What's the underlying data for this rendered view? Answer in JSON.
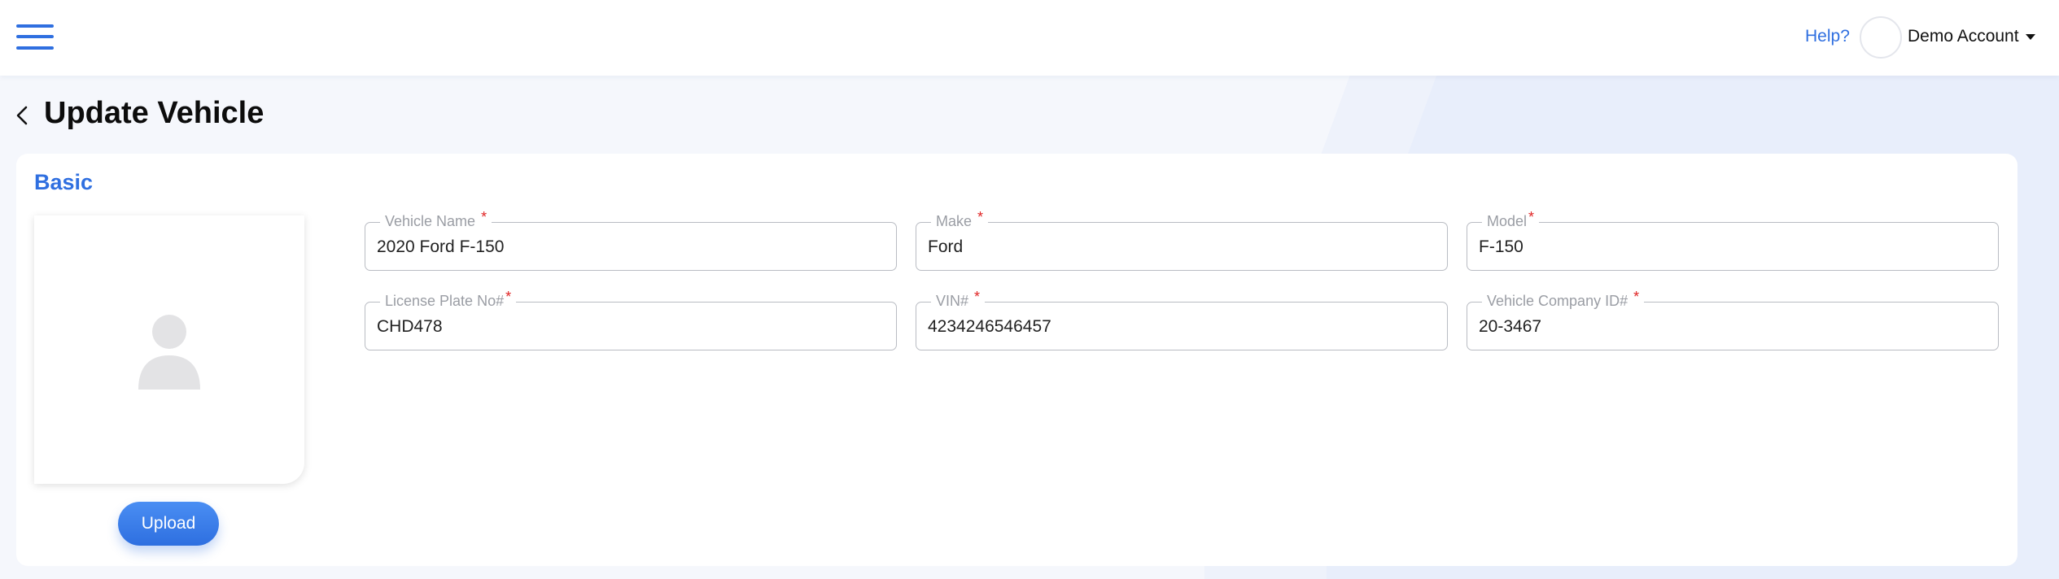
{
  "header": {
    "help_label": "Help?",
    "account_name": "Demo Account",
    "accent_color": "#2f6fe0"
  },
  "page": {
    "title": "Update Vehicle"
  },
  "section": {
    "title": "Basic",
    "upload_label": "Upload"
  },
  "fields": {
    "vehicle_name": {
      "label": "Vehicle Name",
      "required": "*",
      "value": "2020 Ford F-150"
    },
    "make": {
      "label": "Make",
      "required": "*",
      "value": "Ford"
    },
    "model": {
      "label": "Model",
      "required": "*",
      "value": "F-150"
    },
    "license_plate": {
      "label": "License Plate No#",
      "required": "*",
      "value": "CHD478"
    },
    "vin": {
      "label": "VIN#",
      "required": "*",
      "value": "4234246546457"
    },
    "company_id": {
      "label": "Vehicle Company ID#",
      "required": "*",
      "value": "20-3467"
    }
  },
  "icons": {
    "menu": "hamburger-menu-icon",
    "back": "chevron-left-icon",
    "placeholder": "person-placeholder-icon",
    "account": "caret-down-icon"
  }
}
